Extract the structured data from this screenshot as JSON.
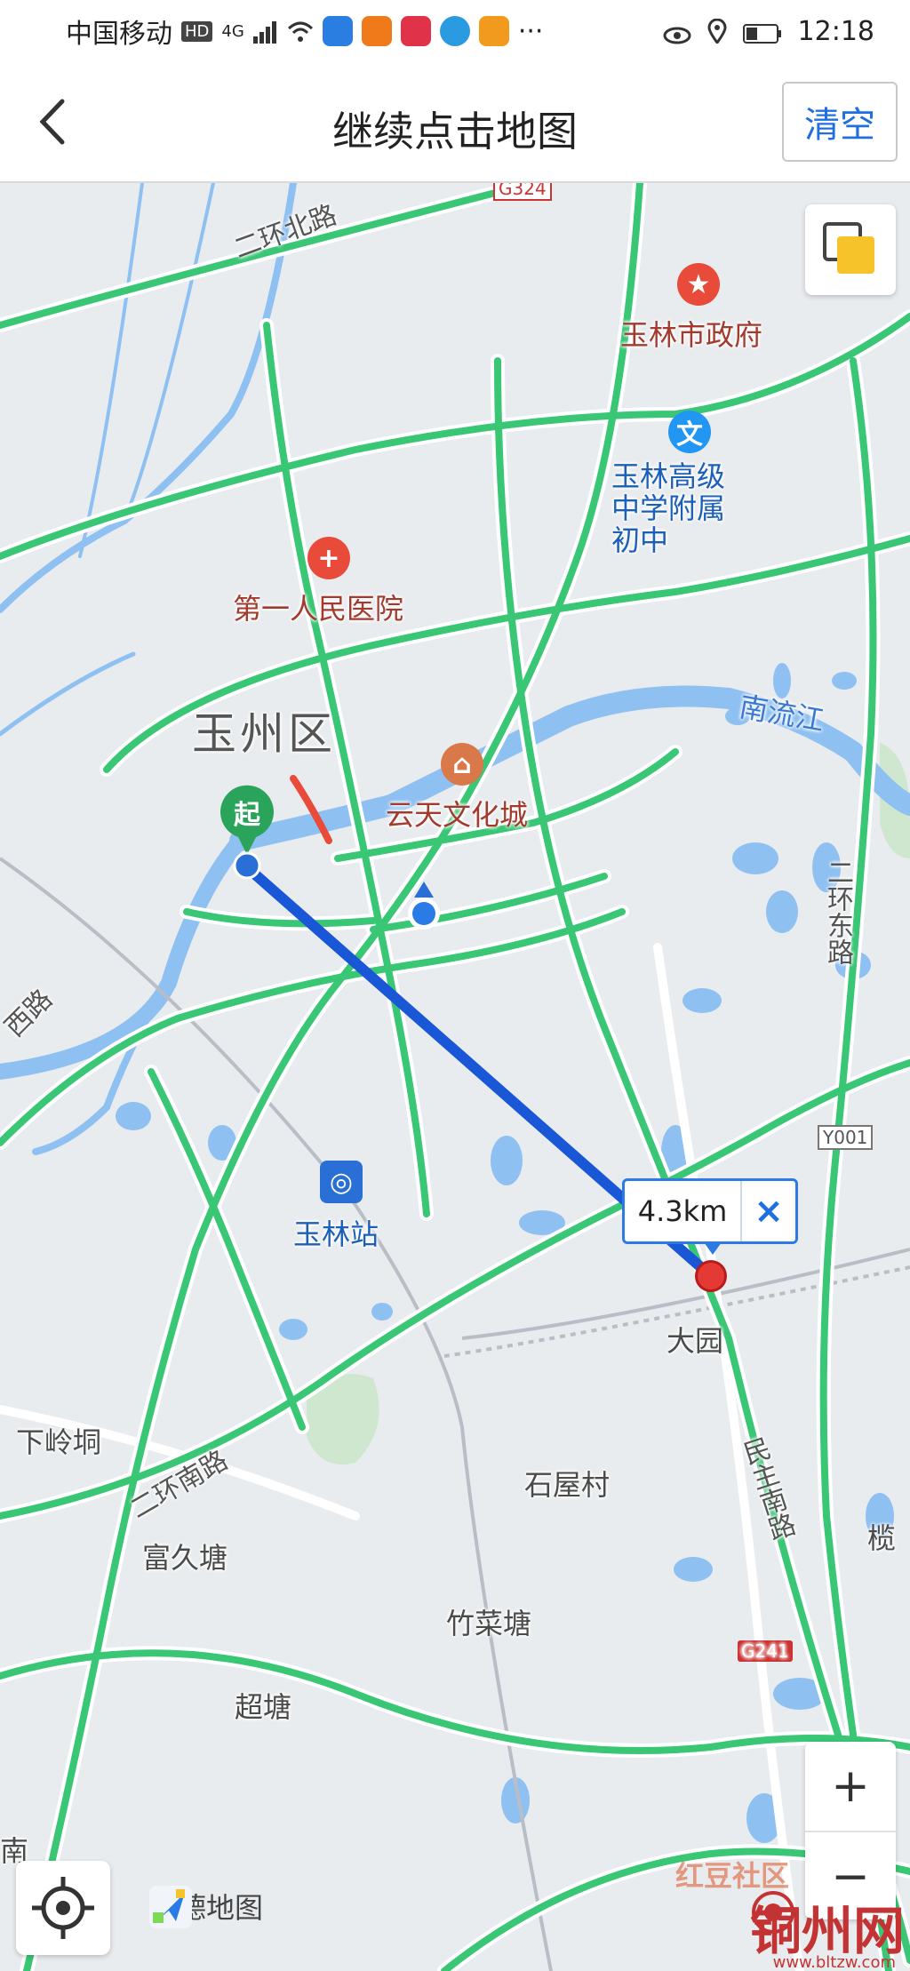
{
  "status_bar": {
    "carrier": "中国移动",
    "hd": "HD",
    "net": "4G",
    "more": "···",
    "time": "12:18"
  },
  "header": {
    "title": "继续点击地图",
    "clear_label": "清空"
  },
  "map": {
    "places": {
      "er_huan_bei_lu": "二环北路",
      "yulin_gov": "玉林市政府",
      "school": "玉林高级中学附属初中",
      "hospital": "第一人民医院",
      "district": "玉州区",
      "yuntian": "云天文化城",
      "nanliu_river": "南流江",
      "er_huan_dong_lu": "二环东路",
      "xi_lu": "西路",
      "y001": "Y001",
      "station": "玉林站",
      "dayuan": "大园",
      "xialingdong": "下岭垌",
      "shiwucun": "石屋村",
      "er_huan_nan_lu": "二环南路",
      "fujiutang": "富久塘",
      "minzhu_nan_lu": "民主南路",
      "lan": "榄",
      "g241": "G241",
      "g324": "G324",
      "zhucaitang": "竹菜塘",
      "chaotang": "超塘",
      "nanlu_bottom": "南"
    },
    "start_pin_label": "起",
    "distance": "4.3km",
    "close_icon": "×",
    "logo_text": "高德地图",
    "zoom_in": "+",
    "zoom_out": "−"
  },
  "watermark": {
    "main": "铜州网",
    "sub": "www.bltzw.com",
    "badge": "红豆社区"
  },
  "colors": {
    "road_green": "#39c675",
    "route_blue": "#1a57d6",
    "water_blue": "#8fc0f2",
    "map_bg": "#e9ecef",
    "accent": "#1f6fe0",
    "end_pin": "#e53935",
    "start_pin": "#2aa45a"
  }
}
